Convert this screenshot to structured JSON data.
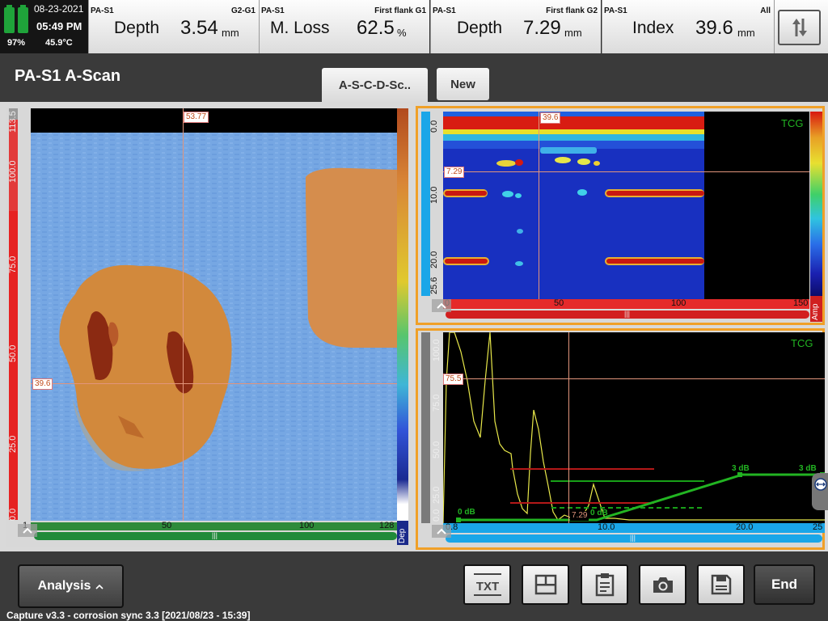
{
  "status": {
    "date": "08-23-2021",
    "time": "05:49 PM",
    "battery": "97%",
    "temperature": "45.9°C"
  },
  "readings": [
    {
      "group": "PA-S1",
      "tag": "G2-G1",
      "name": "Depth",
      "value": "3.54",
      "unit": "mm"
    },
    {
      "group": "PA-S1",
      "tag": "First flank G1",
      "name": "M. Loss",
      "value": "62.5",
      "unit": "%"
    },
    {
      "group": "PA-S1",
      "tag": "First flank G2",
      "name": "Depth",
      "value": "7.29",
      "unit": "mm"
    },
    {
      "group": "PA-S1",
      "tag": "All",
      "name": "Index",
      "value": "39.6",
      "unit": "mm"
    }
  ],
  "header": {
    "title": "PA-S1 A-Scan",
    "tabs": [
      "A-S-C-D-Sc..",
      "New"
    ]
  },
  "cscan": {
    "cursor_x_label": "53.77",
    "cursor_y_label": "39.6",
    "y_ticks": [
      "113.5",
      "100.0",
      "75.0",
      "50.0",
      "25.0",
      "0.0"
    ],
    "x_ticks": [
      "50",
      "100",
      "128"
    ],
    "x_start": "1",
    "colorbar_label": "Dep"
  },
  "bscan": {
    "overlay": "TCG",
    "cursor_x_label": "39.6",
    "cursor_y_label": "7.29",
    "y_ticks": [
      "0.0",
      "10.0",
      "20.0",
      "25.6"
    ],
    "x_ticks": [
      "50",
      "100",
      "150"
    ],
    "x_start": "0",
    "colorbar_label": "Amp"
  },
  "ascan": {
    "overlay": "TCG",
    "cursor_y_label": "75.5",
    "cursor_x_label": "7.29",
    "y_ticks": [
      "100.0",
      "75.0",
      "50.0",
      "25.0",
      "0.0"
    ],
    "x_ticks": [
      "0.8",
      "10.0",
      "20.0",
      "25"
    ],
    "db_labels": [
      "0 dB",
      "3 dB",
      "3 dB",
      "0 dB"
    ]
  },
  "toolbar": {
    "analysis_label": "Analysis",
    "txt_label": "TXT",
    "end_label": "End"
  },
  "footer": {
    "text": "Capture v3.3 - corrosion sync 3.3 [2021/08/23 - 15:39]"
  },
  "colors": {
    "accent": "#f0a028",
    "battery": "#1fa33a",
    "cursor": "#e2957c",
    "tcg": "#22b422"
  }
}
